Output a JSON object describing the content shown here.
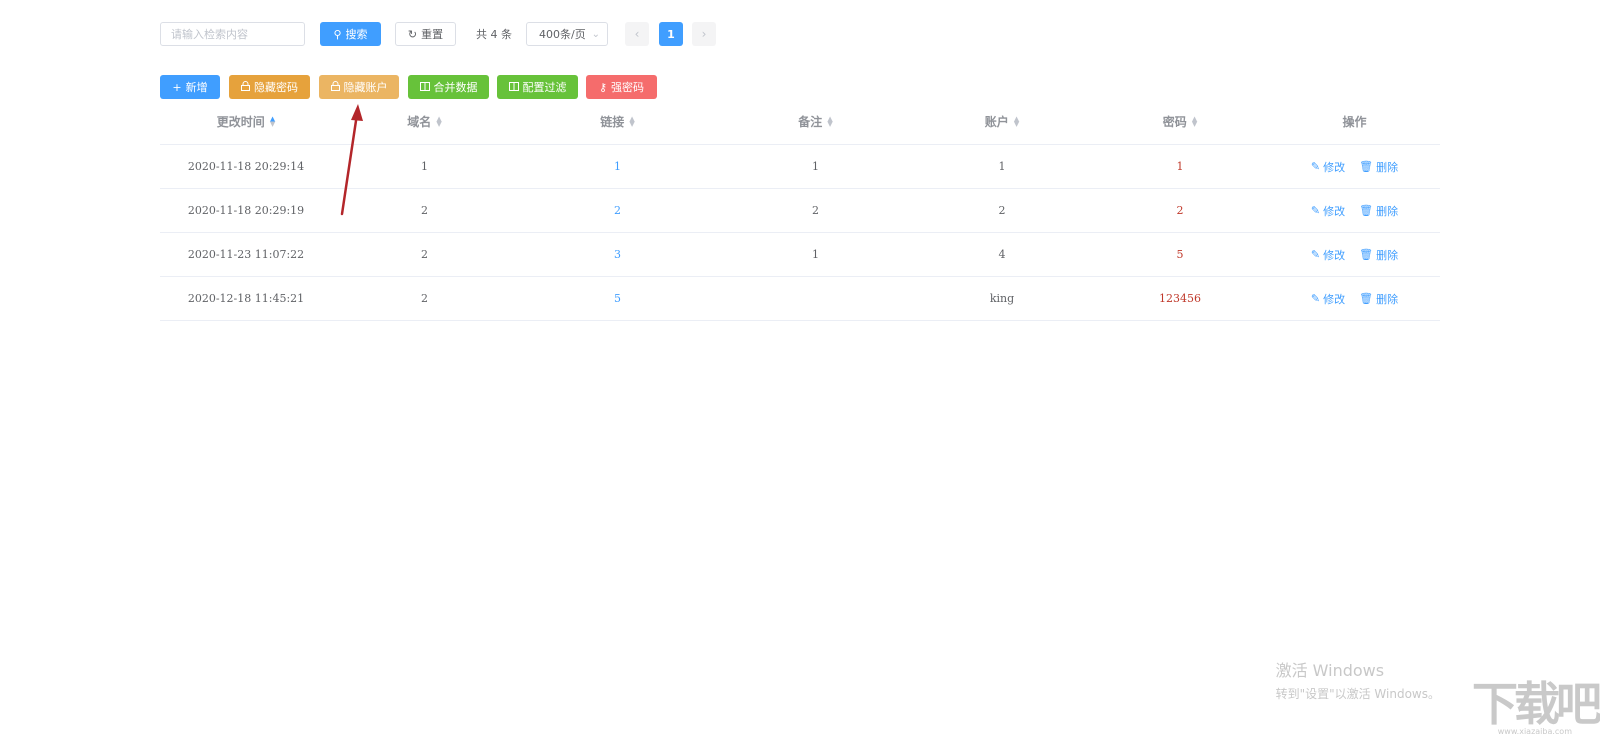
{
  "search": {
    "placeholder": "请输入检索内容",
    "value": ""
  },
  "topbar": {
    "search_label": "搜索",
    "reset_label": "重置",
    "total_text": "共 4 条",
    "page_size": "400条/页",
    "current_page": "1"
  },
  "toolbar": {
    "add": "新增",
    "hide_password": "隐藏密码",
    "hide_account": "隐藏账户",
    "merge_data": "合并数据",
    "config_filter": "配置过滤",
    "strong_password": "强密码"
  },
  "table": {
    "headers": [
      "更改时间",
      "域名",
      "链接",
      "备注",
      "账户",
      "密码",
      "操作"
    ],
    "rows": [
      {
        "time": "2020-11-18 20:29:14",
        "domain": "1",
        "link": "1",
        "note": "1",
        "account": "1",
        "password": "1"
      },
      {
        "time": "2020-11-18 20:29:19",
        "domain": "2",
        "link": "2",
        "note": "2",
        "account": "2",
        "password": "2"
      },
      {
        "time": "2020-11-23 11:07:22",
        "domain": "2",
        "link": "3",
        "note": "1",
        "account": "4",
        "password": "5"
      },
      {
        "time": "2020-12-18 11:45:21",
        "domain": "2",
        "link": "5",
        "note": "",
        "account": "king",
        "password": "123456"
      }
    ],
    "edit_label": "修改",
    "delete_label": "删除"
  },
  "watermark": {
    "title": "激活 Windows",
    "subtitle": "转到\"设置\"以激活 Windows。",
    "logo": "下载吧",
    "url": "www.xiazaiba.com"
  },
  "colors": {
    "primary": "#409eff",
    "warning": "#e6a23c",
    "success": "#67c23a",
    "danger": "#f56c6c",
    "password_text": "#c0392b"
  }
}
